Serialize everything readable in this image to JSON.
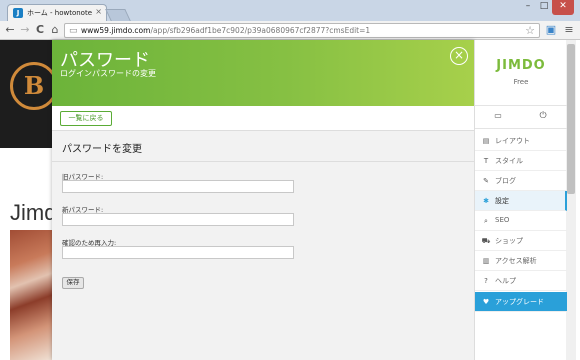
{
  "browser": {
    "tab_title": "ホーム - howtonote ページ",
    "tab_close": "×",
    "favicon": "J",
    "window_controls": {
      "minimize": "–",
      "maximize": "□",
      "close": "✕"
    },
    "nav": {
      "back": "←",
      "forward": "→",
      "reload": "C",
      "home": "⌂"
    },
    "url_prefix": "www59.jimdo.com",
    "url_rest": "/app/sfb296adf1be7c902/p39a0680967cf2877?cmsEdit=1",
    "page_icon": "▭",
    "star": "☆",
    "camera": "▣",
    "menu": "≡"
  },
  "website": {
    "logo_letter": "B",
    "heading": "Jimdo"
  },
  "modal": {
    "title": "パスワード",
    "subtitle": "ログインパスワードの変更",
    "close_symbol": "×",
    "back_label": "一覧に戻る",
    "section_title": "パスワードを変更",
    "fields": [
      {
        "label": "旧パスワード:",
        "value": ""
      },
      {
        "label": "新パスワード:",
        "value": ""
      },
      {
        "label": "確認のため再入力:",
        "value": ""
      }
    ],
    "save_label": "保存"
  },
  "sidebar": {
    "logo": "JIMDO",
    "plan": "Free",
    "monitor_icon": "▭",
    "power_icon": "⏻",
    "items": [
      {
        "label": "レイアウト",
        "icon": "▤"
      },
      {
        "label": "スタイル",
        "icon": "T"
      },
      {
        "label": "ブログ",
        "icon": "✎"
      },
      {
        "label": "設定",
        "icon": "✱"
      },
      {
        "label": "SEO",
        "icon": "⌕"
      },
      {
        "label": "ショップ",
        "icon": "⛟"
      },
      {
        "label": "アクセス解析",
        "icon": "▥"
      },
      {
        "label": "ヘルプ",
        "icon": "?"
      },
      {
        "label": "アップグレード",
        "icon": "♥"
      }
    ]
  },
  "colors": {
    "header_green": "#86c043",
    "accent_blue": "#2aa0d9",
    "logo_orange": "#d08a3a"
  }
}
